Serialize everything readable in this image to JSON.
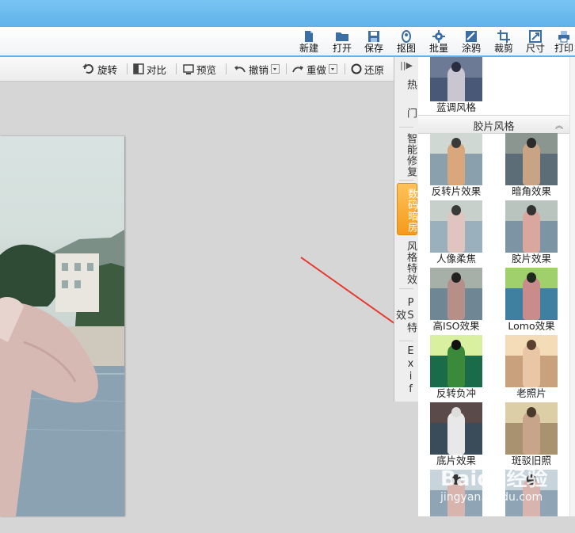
{
  "toolbar": {
    "items": [
      {
        "label": "新建",
        "icon": "new-file-icon"
      },
      {
        "label": "打开",
        "icon": "open-folder-icon"
      },
      {
        "label": "保存",
        "icon": "save-disk-icon"
      },
      {
        "label": "抠图",
        "icon": "cutout-icon"
      },
      {
        "label": "批量",
        "icon": "batch-gear-icon"
      },
      {
        "label": "涂鸦",
        "icon": "graffiti-icon"
      },
      {
        "label": "裁剪",
        "icon": "crop-icon"
      },
      {
        "label": "尺寸",
        "icon": "resize-icon"
      },
      {
        "label": "打印",
        "icon": "printer-icon"
      }
    ]
  },
  "subbar": {
    "rotate": "旋转",
    "compare": "对比",
    "preview": "预览",
    "undo": "撤销",
    "redo": "重做",
    "restore": "还原"
  },
  "vtabs": {
    "toggle": "||▶",
    "items": [
      "热",
      "门",
      "智能修复",
      "数码暗房",
      "风格特效",
      "PS特效",
      "Exif"
    ],
    "active_index": 3
  },
  "panel": {
    "top_item": "蓝调风格",
    "section_title": "胶片风格",
    "effects": [
      "反转片效果",
      "暗角效果",
      "人像柔焦",
      "胶片效果",
      "高ISO效果",
      "Lomo效果",
      "反转负冲",
      "老照片",
      "底片效果",
      "斑驳旧照"
    ]
  },
  "watermark": {
    "text": "Baidu经验",
    "url": "jingyan.baidu.com"
  },
  "colors": {
    "title_blue": "#5fb2ea",
    "active_tab": "#f59a1c",
    "arrow_red": "#e63a2e"
  }
}
